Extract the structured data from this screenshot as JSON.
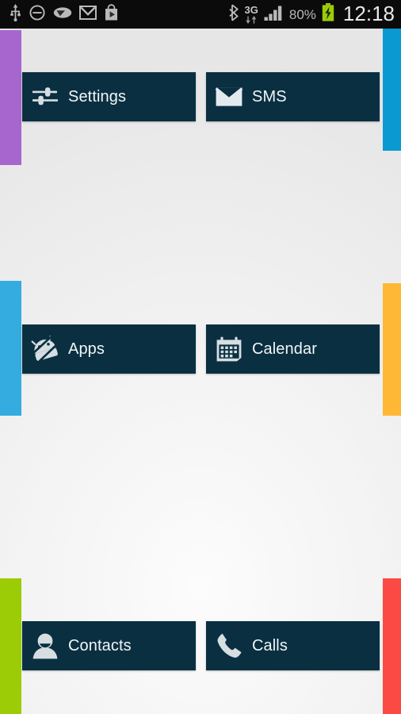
{
  "statusbar": {
    "left_icons": [
      {
        "name": "usb-icon",
        "glyph": "usb"
      },
      {
        "name": "mute-icon",
        "glyph": "circle-minus"
      },
      {
        "name": "pointer-icon",
        "glyph": "pointer-oval"
      },
      {
        "name": "gmail-icon",
        "glyph": "envelope-m"
      },
      {
        "name": "play-store-icon",
        "glyph": "shopping-bag-play"
      }
    ],
    "right_icons": [
      {
        "name": "bluetooth-icon",
        "glyph": "bluetooth"
      },
      {
        "name": "network-type-icon",
        "glyph": "3g-arrows"
      },
      {
        "name": "signal-strength-icon",
        "glyph": "signal-bars"
      },
      {
        "name": "battery-charging-icon",
        "glyph": "battery-bolt"
      }
    ],
    "network_type": "3G",
    "battery_percent": "80%",
    "clock": "12:18",
    "bg_color": "#0B0B0B",
    "icon_color": "#B9B9B9",
    "clock_color": "#E9E9E9",
    "battery_fill_color": "#9ACD08"
  },
  "edge_bars": [
    {
      "name": "edge-bar-purple",
      "color": "#A666CE",
      "side": "left"
    },
    {
      "name": "edge-bar-cyan",
      "color": "#0A9AD1",
      "side": "right"
    },
    {
      "name": "edge-bar-lightblue",
      "color": "#35ACE0",
      "side": "left"
    },
    {
      "name": "edge-bar-orange",
      "color": "#FFB836",
      "side": "right"
    },
    {
      "name": "edge-bar-lime",
      "color": "#9BCC05",
      "side": "left"
    },
    {
      "name": "edge-bar-red",
      "color": "#FB4A43",
      "side": "right"
    }
  ],
  "theme": {
    "tile_bg": "#0A2F41",
    "tile_text": "#F2F6F8",
    "tile_icon": "#D6DEE2",
    "background_light": "#FCFCFC",
    "background_dark": "#E6E6E6"
  },
  "tiles": [
    {
      "id": "settings",
      "label": "Settings",
      "icon": "sliders-icon"
    },
    {
      "id": "sms",
      "label": "SMS",
      "icon": "envelope-icon"
    },
    {
      "id": "apps",
      "label": "Apps",
      "icon": "android-robot-icon"
    },
    {
      "id": "calendar",
      "label": "Calendar",
      "icon": "calendar-icon"
    },
    {
      "id": "contacts",
      "label": "Contacts",
      "icon": "person-icon"
    },
    {
      "id": "calls",
      "label": "Calls",
      "icon": "phone-handset-icon"
    }
  ]
}
